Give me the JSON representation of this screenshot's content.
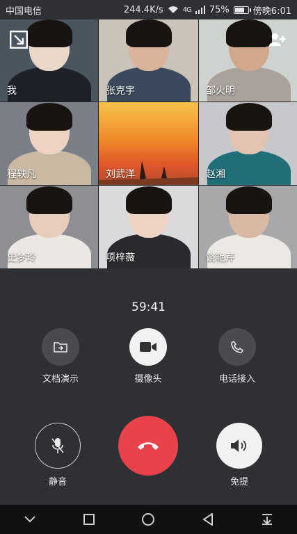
{
  "status_bar": {
    "carrier": "中国电信",
    "net_speed": "244.4K/s",
    "signal": "4G",
    "battery_pct": "75%",
    "battery_level": 0.75,
    "time": "傍晚6:01"
  },
  "participants": [
    {
      "name": "我",
      "bg": "#4a5560",
      "skin": "#e9d7c8",
      "shirt": "#1e2228"
    },
    {
      "name": "张克宇",
      "bg": "#c9c3ba",
      "skin": "#d9b49a",
      "shirt": "#3a4a5c"
    },
    {
      "name": "邹火明",
      "bg": "#cfd3cf",
      "skin": "#d2a88c",
      "shirt": "#a8a29a"
    },
    {
      "name": "程轶凡",
      "bg": "#7b8088",
      "skin": "#edd3c3",
      "shirt": "#c9b9a2"
    },
    {
      "name": "刘武洋",
      "bg": "#e88a2c",
      "skin": "",
      "shirt": ""
    },
    {
      "name": "赵湘",
      "bg": "#c6c8cc",
      "skin": "#e2c4b2",
      "shirt": "#1f6e78"
    },
    {
      "name": "史梦玲",
      "bg": "#8d8f93",
      "skin": "#e8cdbd",
      "shirt": "#ece7e2"
    },
    {
      "name": "项梓薇",
      "bg": "#d9dadc",
      "skin": "#ecd3c4",
      "shirt": "#2a2a2e"
    },
    {
      "name": "饶艳芹",
      "bg": "#a6a8aa",
      "skin": "#d9b8a4",
      "shirt": "#ece8e4"
    }
  ],
  "call_timer": "59:41",
  "controls": {
    "share_doc": "文档演示",
    "camera": "摄像头",
    "phone_in": "电话接入",
    "mute": "静音",
    "speaker": "免提"
  },
  "colors": {
    "background": "#2f3033",
    "end_call": "#e8434b",
    "active_button": "#f2f2f2",
    "inactive_button": "#4a4b4f"
  },
  "icons": {
    "minimize": "minimize-window-icon",
    "add_member": "add-member-icon",
    "share_doc": "share-screen-icon",
    "camera": "video-camera-icon",
    "phone_in": "phone-icon",
    "mute": "microphone-muted-icon",
    "hangup": "hang-up-icon",
    "speaker": "speaker-icon"
  }
}
